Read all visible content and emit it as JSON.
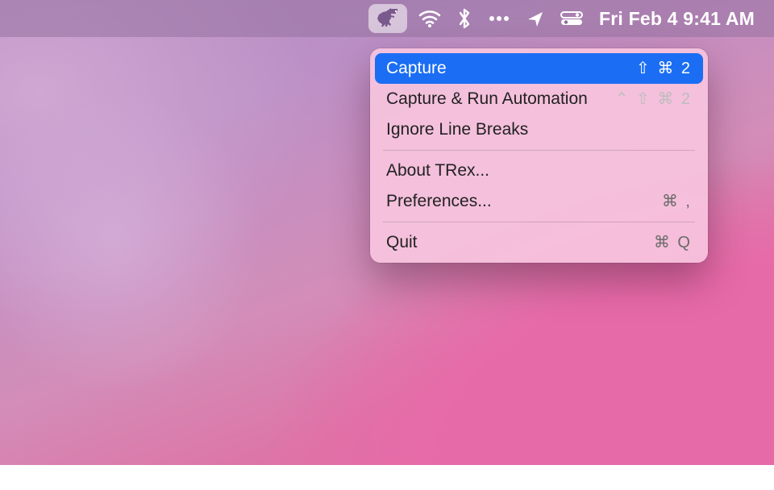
{
  "menubar": {
    "clock": "Fri Feb 4  9:41 AM"
  },
  "menu": {
    "items": [
      {
        "label": "Capture",
        "shortcut": "⇧ ⌘ 2"
      },
      {
        "label": "Capture & Run Automation",
        "shortcut": "⌃ ⇧ ⌘ 2"
      },
      {
        "label": "Ignore Line Breaks",
        "shortcut": ""
      },
      {
        "label": "About TRex...",
        "shortcut": ""
      },
      {
        "label": "Preferences...",
        "shortcut": "⌘ ,"
      },
      {
        "label": "Quit",
        "shortcut": "⌘ Q"
      }
    ]
  }
}
